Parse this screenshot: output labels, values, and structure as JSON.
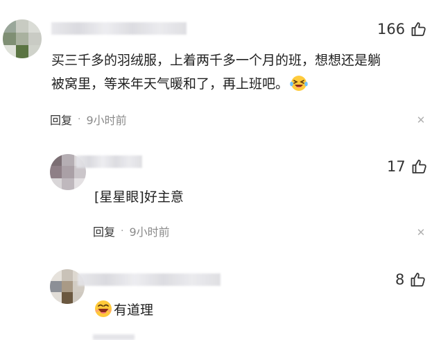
{
  "comments": [
    {
      "likes": "166",
      "text_line1": "买三千多的羽绒服，上着两千多一个月的班，想想还是躺",
      "text_line2": "被窝里，等来年天气暖和了，再上班吧。",
      "reply_label": "回复",
      "separator": "·",
      "time": "9小时前"
    },
    {
      "likes": "17",
      "text": "[星星眼]好主意",
      "reply_label": "回复",
      "separator": "·",
      "time": "9小时前"
    },
    {
      "likes": "8",
      "text": "有道理"
    }
  ],
  "icons": {
    "like": "thumbs-up-icon",
    "close": "close-icon",
    "laugh": "laughing-emoji-icon",
    "grin": "grinning-emoji-icon"
  },
  "colors": {
    "background": "#ffffff",
    "text": "#1f1f1f",
    "meta": "#8a8a8a"
  }
}
